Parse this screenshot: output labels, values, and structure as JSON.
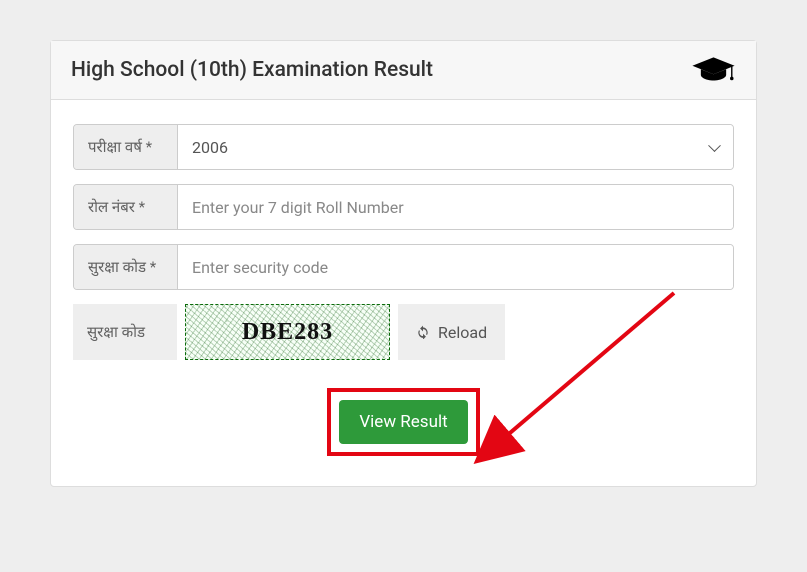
{
  "panel": {
    "title": "High School (10th) Examination Result"
  },
  "fields": {
    "year": {
      "label": "परीक्षा वर्ष *",
      "value": "2006"
    },
    "roll": {
      "label": "रोल नंबर *",
      "placeholder": "Enter your 7 digit Roll Number"
    },
    "code": {
      "label": "सुरक्षा कोड *",
      "placeholder": "Enter security code"
    }
  },
  "captcha": {
    "label": "सुरक्षा कोड",
    "value": "DBE283",
    "reload": "Reload"
  },
  "submit": {
    "label": "View Result"
  }
}
